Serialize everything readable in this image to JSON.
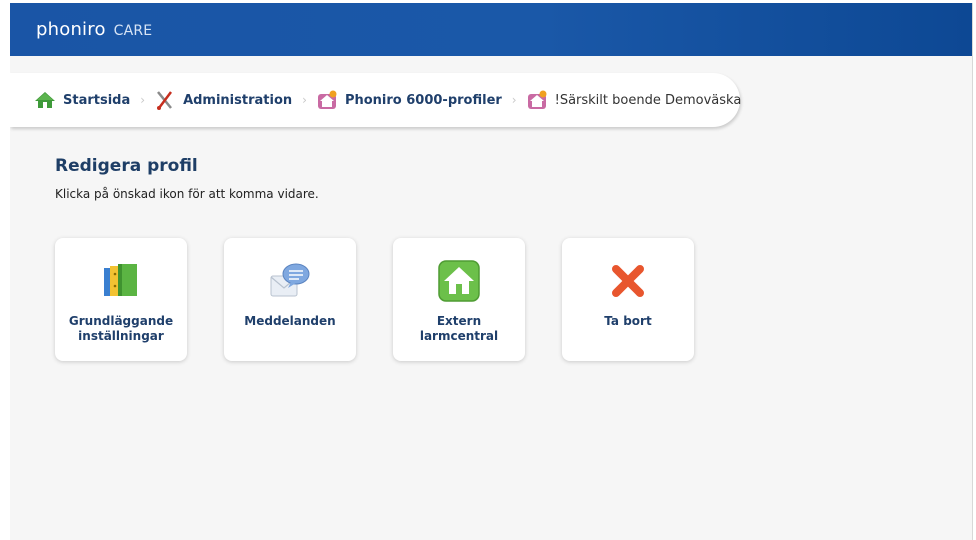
{
  "app": {
    "logo_main": "phoniro",
    "logo_sub": "CARE"
  },
  "breadcrumb": {
    "items": [
      {
        "label": "Startsida",
        "icon": "home-icon"
      },
      {
        "label": "Administration",
        "icon": "tools-icon"
      },
      {
        "label": "Phoniro 6000-profiler",
        "icon": "profile-house-icon"
      },
      {
        "label": "!Särskilt boende Demoväska",
        "icon": "profile-house-icon"
      }
    ],
    "separator": "›"
  },
  "main": {
    "title": "Redigera profil",
    "instruction": "Klicka på önskad ikon för att komma vidare."
  },
  "tiles": [
    {
      "label": "Grundläggande\ninställningar",
      "icon": "binders-icon"
    },
    {
      "label": "Meddelanden",
      "icon": "messages-icon"
    },
    {
      "label": "Extern\nlarmcentral",
      "icon": "home-alarm-icon"
    },
    {
      "label": "Ta bort",
      "icon": "delete-icon"
    }
  ],
  "colors": {
    "header": "#1a55a6",
    "link_text": "#1f3f6b",
    "delete": "#e8562e",
    "home_green": "#6cc04a"
  }
}
